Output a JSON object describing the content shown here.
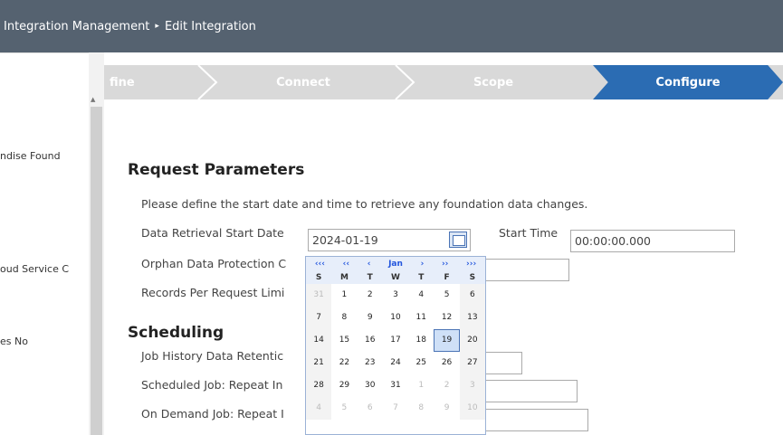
{
  "breadcrumb": {
    "parent": "Integration Management",
    "separator": "▸",
    "current": "Edit Integration"
  },
  "sidebar": {
    "items": [
      {
        "label": ""
      },
      {
        "label": "ndise Found"
      },
      {
        "label": "oud Service C"
      },
      {
        "label": "es No"
      }
    ]
  },
  "steps": [
    {
      "label": "fine"
    },
    {
      "label": "Connect"
    },
    {
      "label": "Scope"
    },
    {
      "label": "Configure"
    }
  ],
  "request": {
    "title": "Request Parameters",
    "description": "Please define the start date and time to retrieve any foundation data changes.",
    "start_date_label": "Data Retrieval Start Date",
    "start_date_value": "2024-01-19",
    "start_time_label": "Start Time",
    "start_time_value": "00:00:00.000",
    "orphan_label": "Orphan Data Protection C",
    "records_label": "Records Per Request Limi"
  },
  "scheduling": {
    "title": "Scheduling",
    "history_label": "Job History Data Retentic",
    "scheduled_label": "Scheduled Job: Repeat In",
    "ondemand_label": "On Demand Job: Repeat I"
  },
  "calendar": {
    "nav": [
      "‹‹‹",
      "‹‹",
      "‹",
      "Jan",
      "›",
      "››",
      "›››"
    ],
    "weekdays": [
      "S",
      "M",
      "T",
      "W",
      "T",
      "F",
      "S"
    ],
    "weeks": [
      [
        "31",
        "1",
        "2",
        "3",
        "4",
        "5",
        "6"
      ],
      [
        "7",
        "8",
        "9",
        "10",
        "11",
        "12",
        "13"
      ],
      [
        "14",
        "15",
        "16",
        "17",
        "18",
        "19",
        "20"
      ],
      [
        "21",
        "22",
        "23",
        "24",
        "25",
        "26",
        "27"
      ],
      [
        "28",
        "29",
        "30",
        "31",
        "1",
        "2",
        "3"
      ],
      [
        "4",
        "5",
        "6",
        "7",
        "8",
        "9",
        "10"
      ]
    ],
    "selected": "19"
  }
}
